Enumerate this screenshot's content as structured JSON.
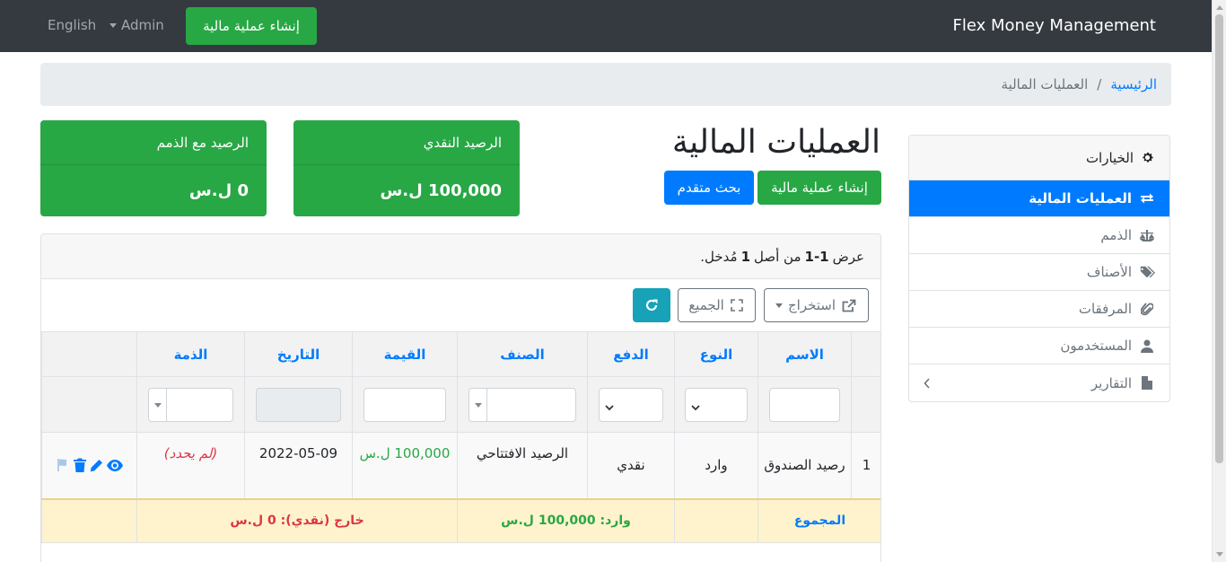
{
  "navbar": {
    "brand": "Flex Money Management",
    "create_button": "إنشاء عملية مالية",
    "admin_menu": "Admin",
    "language": "English"
  },
  "breadcrumb": {
    "home": "الرئيسية",
    "separator": "/",
    "current": "العمليات المالية"
  },
  "sidebar": {
    "header": "الخيارات",
    "header_icon": "gear-icon",
    "items": [
      {
        "label": "العمليات المالية",
        "icon": "exchange-icon",
        "active": true
      },
      {
        "label": "الذمم",
        "icon": "scale-icon",
        "active": false
      },
      {
        "label": "الأصناف",
        "icon": "tags-icon",
        "active": false
      },
      {
        "label": "المرفقات",
        "icon": "paperclip-icon",
        "active": false
      },
      {
        "label": "المستخدمون",
        "icon": "user-icon",
        "active": false
      },
      {
        "label": "التقارير",
        "icon": "file-icon",
        "active": false
      }
    ]
  },
  "page": {
    "title": "العمليات المالية",
    "create_button": "إنشاء عملية مالية",
    "advanced_search_button": "بحث متقدم"
  },
  "cards": [
    {
      "label": "الرصيد النقدي",
      "value": "100,000 ل.س"
    },
    {
      "label": "الرصيد مع الذمم",
      "value": "0 ل.س"
    }
  ],
  "grid": {
    "summary_prefix": "عرض",
    "summary_range": "1-1",
    "summary_mid": "من أصل",
    "summary_total": "1",
    "summary_suffix": "مُدخل.",
    "export_button": "استخراج",
    "all_button": "الجميع",
    "columns": [
      "الاسم",
      "النوع",
      "الدفع",
      "الصنف",
      "القيمة",
      "التاريخ",
      "الذمة"
    ],
    "rows": [
      {
        "index": "1",
        "name": "رصيد الصندوق",
        "type": "وارد",
        "payment": "نقدي",
        "category": "الرصيد الافتتاحي",
        "value": "100,000 ل.س",
        "date": "2022-05-09",
        "account": "(لم يحدد)"
      }
    ],
    "footer": {
      "label": "المجموع",
      "incoming": "وارد: 100,000 ل.س",
      "outgoing": "خارج (نقدي): 0 ل.س"
    }
  },
  "colors": {
    "navbar": "#343a40",
    "primary": "#007bff",
    "success": "#28a745",
    "info": "#17a2b8",
    "danger": "#dc3545",
    "footer_bg": "#fff3cd"
  }
}
